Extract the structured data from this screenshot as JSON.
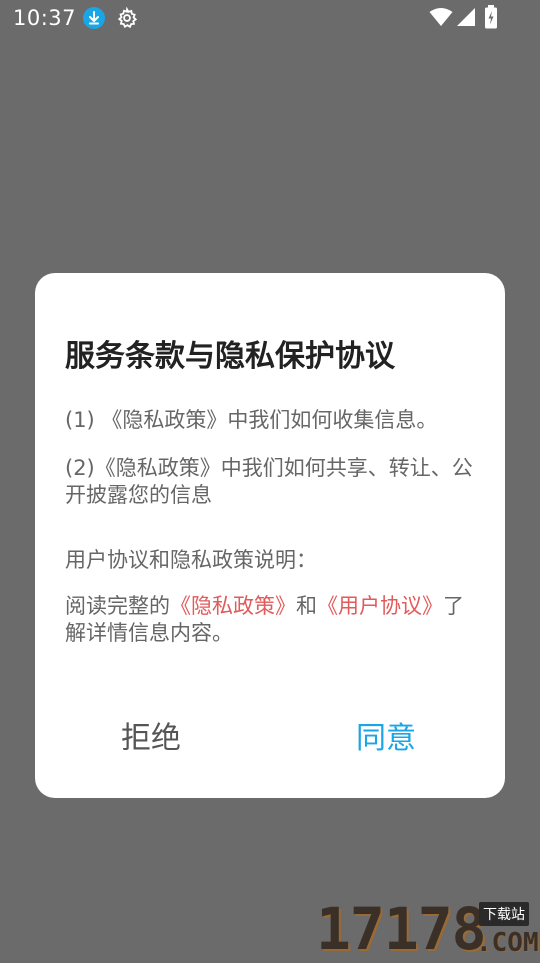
{
  "status_bar": {
    "time": "10:37",
    "icons": [
      "download-icon",
      "gear-icon",
      "wifi-icon",
      "signal-icon",
      "battery-icon"
    ],
    "download_icon_color": "#1aa6e6"
  },
  "dialog": {
    "title": "服务条款与隐私保护协议",
    "para1": "(1) 《隐私政策》中我们如何收集信息。",
    "para2": "(2)《隐私政策》中我们如何共享、转让、公开披露您的信息",
    "para3": "用户协议和隐私政策说明：",
    "para4": {
      "prefix": "阅读完整的",
      "link1": "《隐私政策》",
      "middle": "和",
      "link2": "《用户协议》",
      "suffix": "了解详情信息内容。"
    },
    "refuse_label": "拒绝",
    "agree_label": "同意",
    "link_color": "#e25a5a",
    "agree_color": "#1aa6e6"
  },
  "watermark": {
    "number": "17178",
    "tag": "下载站",
    "com": ".COM"
  }
}
